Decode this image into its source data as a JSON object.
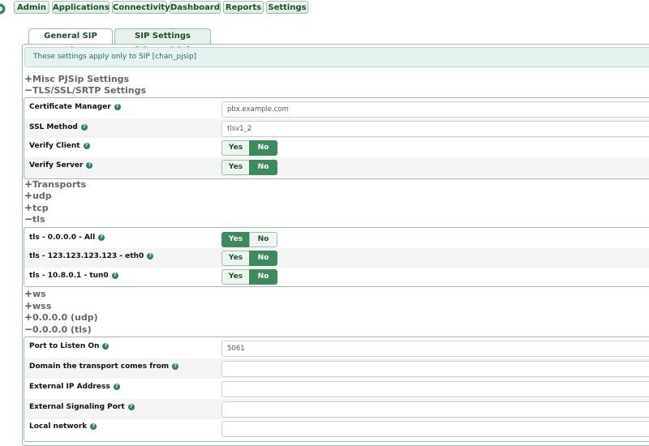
{
  "nav": {
    "admin": "Admin",
    "applications": "Applications",
    "connectivity": "Connectivity",
    "dashboard": "Dashboard",
    "reports": "Reports",
    "settings": "Settings"
  },
  "tabs": {
    "general": "General SIP Settings",
    "pjsip": "SIP Settings [chan_pjsip]"
  },
  "info_text": "These settings apply only to SIP [chan_pjsip]",
  "sections": {
    "misc": "Misc PJSip Settings",
    "tls_ssl": "TLS/SSL/SRTP Settings",
    "transports": "Transports",
    "udp": "udp",
    "tcp": "tcp",
    "tls": "tls",
    "ws": "ws",
    "wss": "wss",
    "udp_all": "0.0.0.0 (udp)",
    "tls_all": "0.0.0.0 (tls)"
  },
  "tls_settings": {
    "cert_label": "Certificate Manager",
    "cert_value": "pbx.example.com",
    "ssl_label": "SSL Method",
    "ssl_value": "tlsv1_2",
    "verify_client_label": "Verify Client",
    "verify_client": "No",
    "verify_server_label": "Verify Server",
    "verify_server": "No"
  },
  "tls_transports": {
    "all_label": "tls - 0.0.0.0 - All",
    "all_value": "Yes",
    "eth0_label": "tls - 123.123.123.123 - eth0",
    "eth0_value": "No",
    "tun0_label": "tls - 10.8.0.1 - tun0",
    "tun0_value": "No"
  },
  "tls_all_settings": {
    "port_label": "Port to Listen On",
    "port_value": "5061",
    "domain_label": "Domain the transport comes from",
    "domain_value": "",
    "extip_label": "External IP Address",
    "extip_value": "",
    "extport_label": "External Signaling Port",
    "extport_value": "",
    "localnet_label": "Local network",
    "localnet_value": ""
  },
  "toggle_labels": {
    "yes": "Yes",
    "no": "No"
  },
  "help_glyph": "?",
  "icons": {
    "logo": "freepbx-logo",
    "help": "help-icon",
    "expand": "plus-icon",
    "collapse": "minus-icon"
  },
  "colors": {
    "accent": "#3d8a5d",
    "border": "#9cbfa8",
    "info_bg": "#e6f2ef"
  }
}
